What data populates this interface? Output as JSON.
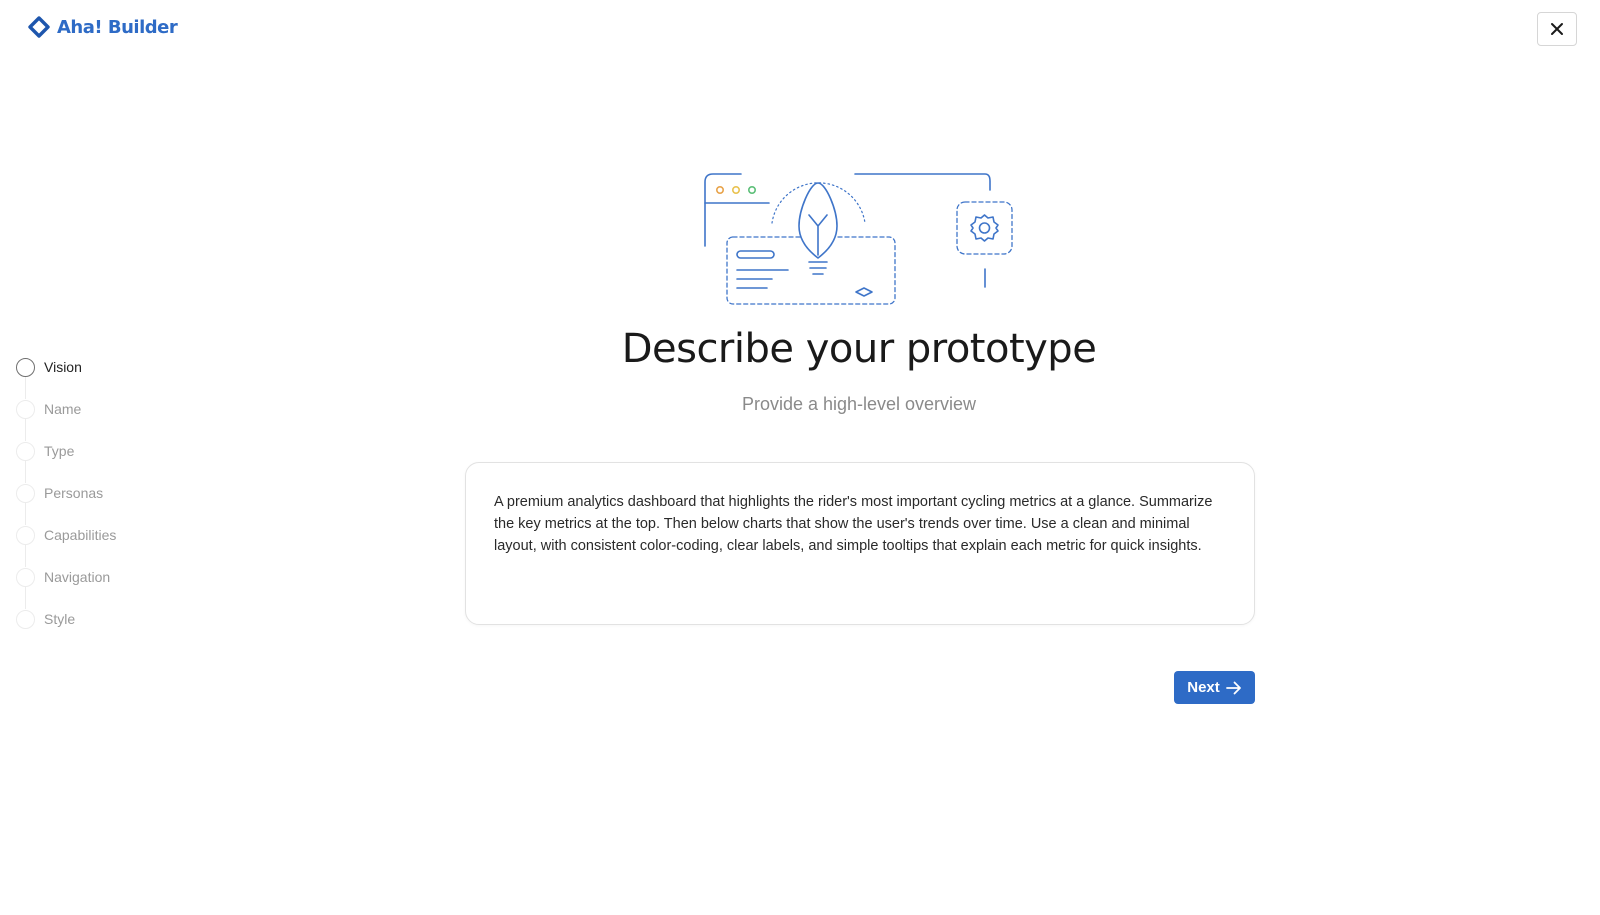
{
  "header": {
    "app_name": "Aha! Builder",
    "logo_icon": "aha-diamond-icon",
    "close_icon": "close-icon"
  },
  "steps": [
    {
      "label": "Vision",
      "active": true
    },
    {
      "label": "Name",
      "active": false
    },
    {
      "label": "Type",
      "active": false
    },
    {
      "label": "Personas",
      "active": false
    },
    {
      "label": "Capabilities",
      "active": false
    },
    {
      "label": "Navigation",
      "active": false
    },
    {
      "label": "Style",
      "active": false
    }
  ],
  "main": {
    "illustration_icon": "lightbulb-idea-icon",
    "title": "Describe your prototype",
    "subtitle": "Provide a high-level overview",
    "description": "A premium analytics dashboard that highlights the rider's most important cycling metrics at a glance. Summarize the key metrics at the top. Then below charts that show the user's trends over time. Use a clean and minimal layout, with consistent color-coding, clear labels, and simple tooltips that explain each metric for quick insights.",
    "next_label": "Next",
    "next_icon": "arrow-right-icon"
  },
  "colors": {
    "brand": "#2e6bc6",
    "illustration_stroke": "#3f75c9",
    "dot_orange": "#e8a34a",
    "dot_yellow": "#e9c24f",
    "dot_green": "#5cbf78"
  }
}
